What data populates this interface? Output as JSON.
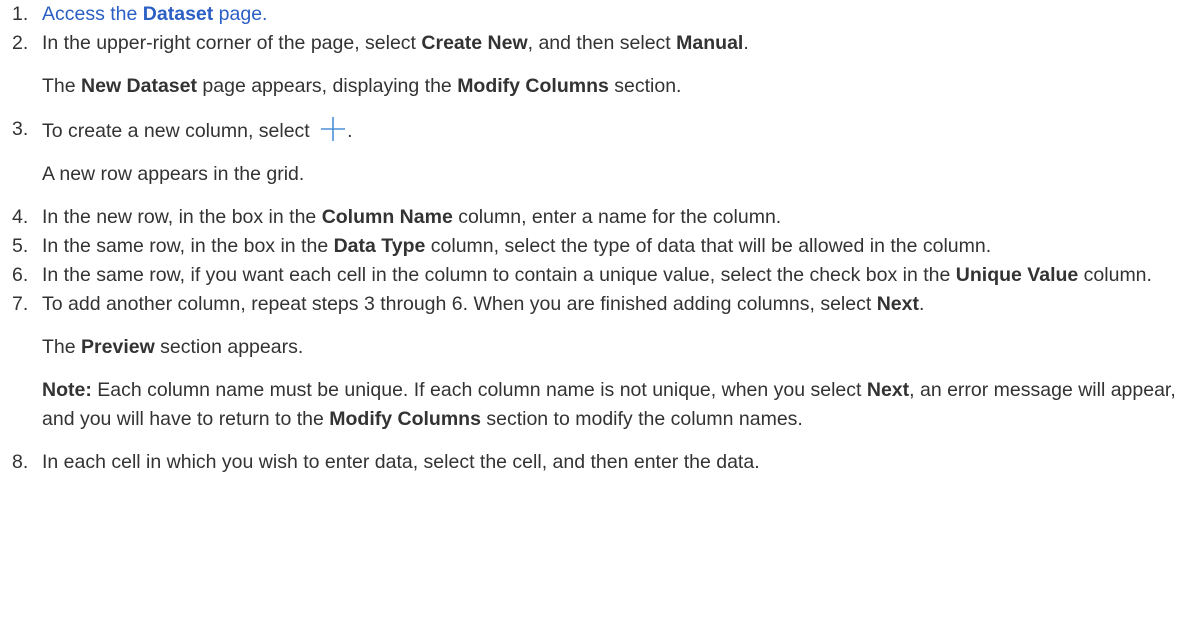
{
  "steps": [
    {
      "num": "1.",
      "a": "Access the ",
      "b": "Dataset",
      "c": " page."
    },
    {
      "num": "2.",
      "a": "In the upper-right corner of the page, select ",
      "b": "Create New",
      "c": ", and then select ",
      "d": "Manual",
      "e": ".",
      "r1": "The ",
      "r2": "New Dataset",
      "r3": " page appears, displaying the ",
      "r4": "Modify Columns",
      "r5": " section."
    },
    {
      "num": "3.",
      "a": "To create a new column, select ",
      "c": ".",
      "r1": "A new row appears in the grid."
    },
    {
      "num": "4.",
      "a": "In the new row, in the box in the ",
      "b": "Column Name",
      "c": " column, enter a name for the column."
    },
    {
      "num": "5.",
      "a": "In the same row, in the box in the ",
      "b": "Data Type",
      "c": " column, select the type of data that will be allowed in the column."
    },
    {
      "num": "6.",
      "a": "In the same row, if you want each cell in the column to contain a unique value, select the check box in the ",
      "b": "Unique Value",
      "c": " column."
    },
    {
      "num": "7.",
      "a": "To add another column, repeat steps 3 through 6. When you are finished adding columns, select ",
      "b": "Next",
      "c": ".",
      "r1": "The ",
      "r2": "Preview",
      "r3": " section appears.",
      "n1": "Note:",
      "n2": " Each column name must be unique. If each column name is not unique, when you select ",
      "n3": "Next",
      "n4": ", an error message will appear, and you will have to return to the ",
      "n5": "Modify Columns",
      "n6": " section to modify the column names."
    },
    {
      "num": "8.",
      "a": "In each cell in which you wish to enter data, select the cell, and then enter the data."
    }
  ],
  "colors": {
    "text": "#333333",
    "link": "#2b5fc4",
    "icon": "#4a8fd8"
  },
  "icons": {
    "add": "plus-icon"
  }
}
